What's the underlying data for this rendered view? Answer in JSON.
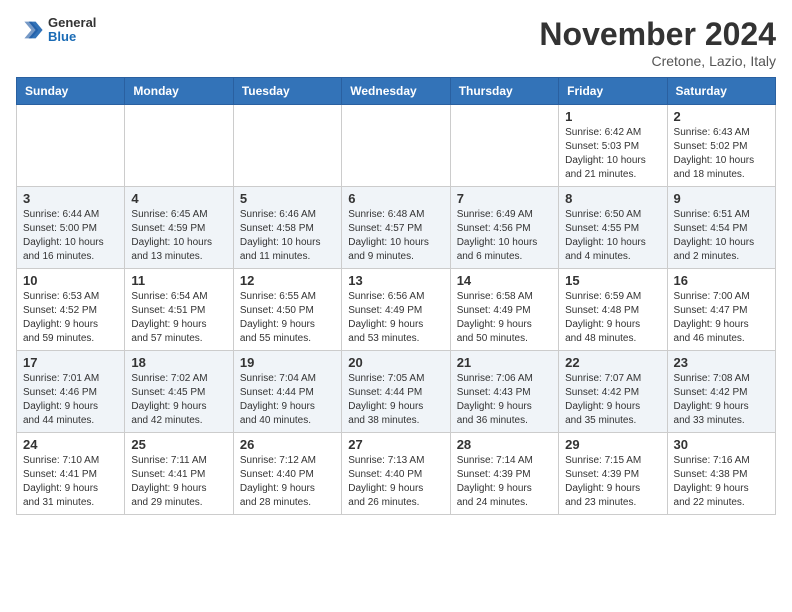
{
  "header": {
    "logo": {
      "general": "General",
      "blue": "Blue"
    },
    "title": "November 2024",
    "location": "Cretone, Lazio, Italy"
  },
  "days_of_week": [
    "Sunday",
    "Monday",
    "Tuesday",
    "Wednesday",
    "Thursday",
    "Friday",
    "Saturday"
  ],
  "weeks": [
    [
      {
        "day": "",
        "info": ""
      },
      {
        "day": "",
        "info": ""
      },
      {
        "day": "",
        "info": ""
      },
      {
        "day": "",
        "info": ""
      },
      {
        "day": "",
        "info": ""
      },
      {
        "day": "1",
        "info": "Sunrise: 6:42 AM\nSunset: 5:03 PM\nDaylight: 10 hours\nand 21 minutes."
      },
      {
        "day": "2",
        "info": "Sunrise: 6:43 AM\nSunset: 5:02 PM\nDaylight: 10 hours\nand 18 minutes."
      }
    ],
    [
      {
        "day": "3",
        "info": "Sunrise: 6:44 AM\nSunset: 5:00 PM\nDaylight: 10 hours\nand 16 minutes."
      },
      {
        "day": "4",
        "info": "Sunrise: 6:45 AM\nSunset: 4:59 PM\nDaylight: 10 hours\nand 13 minutes."
      },
      {
        "day": "5",
        "info": "Sunrise: 6:46 AM\nSunset: 4:58 PM\nDaylight: 10 hours\nand 11 minutes."
      },
      {
        "day": "6",
        "info": "Sunrise: 6:48 AM\nSunset: 4:57 PM\nDaylight: 10 hours\nand 9 minutes."
      },
      {
        "day": "7",
        "info": "Sunrise: 6:49 AM\nSunset: 4:56 PM\nDaylight: 10 hours\nand 6 minutes."
      },
      {
        "day": "8",
        "info": "Sunrise: 6:50 AM\nSunset: 4:55 PM\nDaylight: 10 hours\nand 4 minutes."
      },
      {
        "day": "9",
        "info": "Sunrise: 6:51 AM\nSunset: 4:54 PM\nDaylight: 10 hours\nand 2 minutes."
      }
    ],
    [
      {
        "day": "10",
        "info": "Sunrise: 6:53 AM\nSunset: 4:52 PM\nDaylight: 9 hours\nand 59 minutes."
      },
      {
        "day": "11",
        "info": "Sunrise: 6:54 AM\nSunset: 4:51 PM\nDaylight: 9 hours\nand 57 minutes."
      },
      {
        "day": "12",
        "info": "Sunrise: 6:55 AM\nSunset: 4:50 PM\nDaylight: 9 hours\nand 55 minutes."
      },
      {
        "day": "13",
        "info": "Sunrise: 6:56 AM\nSunset: 4:49 PM\nDaylight: 9 hours\nand 53 minutes."
      },
      {
        "day": "14",
        "info": "Sunrise: 6:58 AM\nSunset: 4:49 PM\nDaylight: 9 hours\nand 50 minutes."
      },
      {
        "day": "15",
        "info": "Sunrise: 6:59 AM\nSunset: 4:48 PM\nDaylight: 9 hours\nand 48 minutes."
      },
      {
        "day": "16",
        "info": "Sunrise: 7:00 AM\nSunset: 4:47 PM\nDaylight: 9 hours\nand 46 minutes."
      }
    ],
    [
      {
        "day": "17",
        "info": "Sunrise: 7:01 AM\nSunset: 4:46 PM\nDaylight: 9 hours\nand 44 minutes."
      },
      {
        "day": "18",
        "info": "Sunrise: 7:02 AM\nSunset: 4:45 PM\nDaylight: 9 hours\nand 42 minutes."
      },
      {
        "day": "19",
        "info": "Sunrise: 7:04 AM\nSunset: 4:44 PM\nDaylight: 9 hours\nand 40 minutes."
      },
      {
        "day": "20",
        "info": "Sunrise: 7:05 AM\nSunset: 4:44 PM\nDaylight: 9 hours\nand 38 minutes."
      },
      {
        "day": "21",
        "info": "Sunrise: 7:06 AM\nSunset: 4:43 PM\nDaylight: 9 hours\nand 36 minutes."
      },
      {
        "day": "22",
        "info": "Sunrise: 7:07 AM\nSunset: 4:42 PM\nDaylight: 9 hours\nand 35 minutes."
      },
      {
        "day": "23",
        "info": "Sunrise: 7:08 AM\nSunset: 4:42 PM\nDaylight: 9 hours\nand 33 minutes."
      }
    ],
    [
      {
        "day": "24",
        "info": "Sunrise: 7:10 AM\nSunset: 4:41 PM\nDaylight: 9 hours\nand 31 minutes."
      },
      {
        "day": "25",
        "info": "Sunrise: 7:11 AM\nSunset: 4:41 PM\nDaylight: 9 hours\nand 29 minutes."
      },
      {
        "day": "26",
        "info": "Sunrise: 7:12 AM\nSunset: 4:40 PM\nDaylight: 9 hours\nand 28 minutes."
      },
      {
        "day": "27",
        "info": "Sunrise: 7:13 AM\nSunset: 4:40 PM\nDaylight: 9 hours\nand 26 minutes."
      },
      {
        "day": "28",
        "info": "Sunrise: 7:14 AM\nSunset: 4:39 PM\nDaylight: 9 hours\nand 24 minutes."
      },
      {
        "day": "29",
        "info": "Sunrise: 7:15 AM\nSunset: 4:39 PM\nDaylight: 9 hours\nand 23 minutes."
      },
      {
        "day": "30",
        "info": "Sunrise: 7:16 AM\nSunset: 4:38 PM\nDaylight: 9 hours\nand 22 minutes."
      }
    ]
  ]
}
